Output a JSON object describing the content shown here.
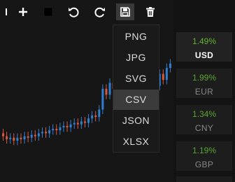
{
  "toolbar": {
    "buttons": [
      {
        "name": "collapse-icon"
      },
      {
        "name": "add-icon"
      },
      {
        "name": "stop-icon"
      },
      {
        "name": "undo-icon"
      },
      {
        "name": "redo-icon"
      },
      {
        "name": "save-icon",
        "active": true
      },
      {
        "name": "delete-icon"
      }
    ]
  },
  "export_menu": {
    "items": [
      "PNG",
      "JPG",
      "SVG",
      "CSV",
      "JSON",
      "XLSX"
    ],
    "highlighted": "CSV"
  },
  "currencies": [
    {
      "change": "1.49%",
      "code": "USD",
      "selected": true
    },
    {
      "change": "1.99%",
      "code": "EUR"
    },
    {
      "change": "1.34%",
      "code": "CNY"
    },
    {
      "change": "1.19%",
      "code": "GBP"
    }
  ],
  "chart_data": {
    "type": "candlestick",
    "colors": {
      "up": "#2f7fd0",
      "down": "#d8583f",
      "background": "#161616"
    },
    "series": [
      {
        "o": 0.3,
        "c": 0.28
      },
      {
        "o": 0.28,
        "c": 0.26
      },
      {
        "o": 0.26,
        "c": 0.27
      },
      {
        "o": 0.27,
        "c": 0.25
      },
      {
        "o": 0.25,
        "c": 0.27
      },
      {
        "o": 0.27,
        "c": 0.26
      },
      {
        "o": 0.26,
        "c": 0.28
      },
      {
        "o": 0.28,
        "c": 0.27
      },
      {
        "o": 0.27,
        "c": 0.29
      },
      {
        "o": 0.29,
        "c": 0.28
      },
      {
        "o": 0.28,
        "c": 0.3
      },
      {
        "o": 0.3,
        "c": 0.31
      },
      {
        "o": 0.31,
        "c": 0.3
      },
      {
        "o": 0.3,
        "c": 0.32
      },
      {
        "o": 0.32,
        "c": 0.33
      },
      {
        "o": 0.33,
        "c": 0.32
      },
      {
        "o": 0.32,
        "c": 0.34
      },
      {
        "o": 0.34,
        "c": 0.35
      },
      {
        "o": 0.35,
        "c": 0.34
      },
      {
        "o": 0.34,
        "c": 0.36
      },
      {
        "o": 0.36,
        "c": 0.37
      },
      {
        "o": 0.37,
        "c": 0.36
      },
      {
        "o": 0.36,
        "c": 0.38
      },
      {
        "o": 0.38,
        "c": 0.37
      },
      {
        "o": 0.37,
        "c": 0.4
      },
      {
        "o": 0.4,
        "c": 0.42
      },
      {
        "o": 0.42,
        "c": 0.41
      },
      {
        "o": 0.41,
        "c": 0.46
      },
      {
        "o": 0.46,
        "c": 0.6
      },
      {
        "o": 0.6,
        "c": 0.56
      },
      {
        "o": 0.56,
        "c": 0.64
      },
      {
        "o": 0.64,
        "c": 0.6
      },
      {
        "o": 0.6,
        "c": 0.78
      },
      {
        "o": 0.78,
        "c": 0.72
      },
      {
        "o": 0.72,
        "c": 0.8
      },
      {
        "o": 0.8,
        "c": 0.84
      },
      {
        "o": 0.84,
        "c": 0.8
      },
      {
        "o": 0.8,
        "c": 0.9
      },
      {
        "o": 0.9,
        "c": 0.98
      },
      {
        "o": 0.98,
        "c": 0.86
      },
      {
        "o": 0.86,
        "c": 0.74
      },
      {
        "o": 0.74,
        "c": 0.66
      },
      {
        "o": 0.66,
        "c": 0.72
      },
      {
        "o": 0.72,
        "c": 0.62
      },
      {
        "o": 0.62,
        "c": 0.7
      },
      {
        "o": 0.7,
        "c": 0.66
      },
      {
        "o": 0.66,
        "c": 0.74
      },
      {
        "o": 0.74,
        "c": 0.77
      }
    ]
  }
}
